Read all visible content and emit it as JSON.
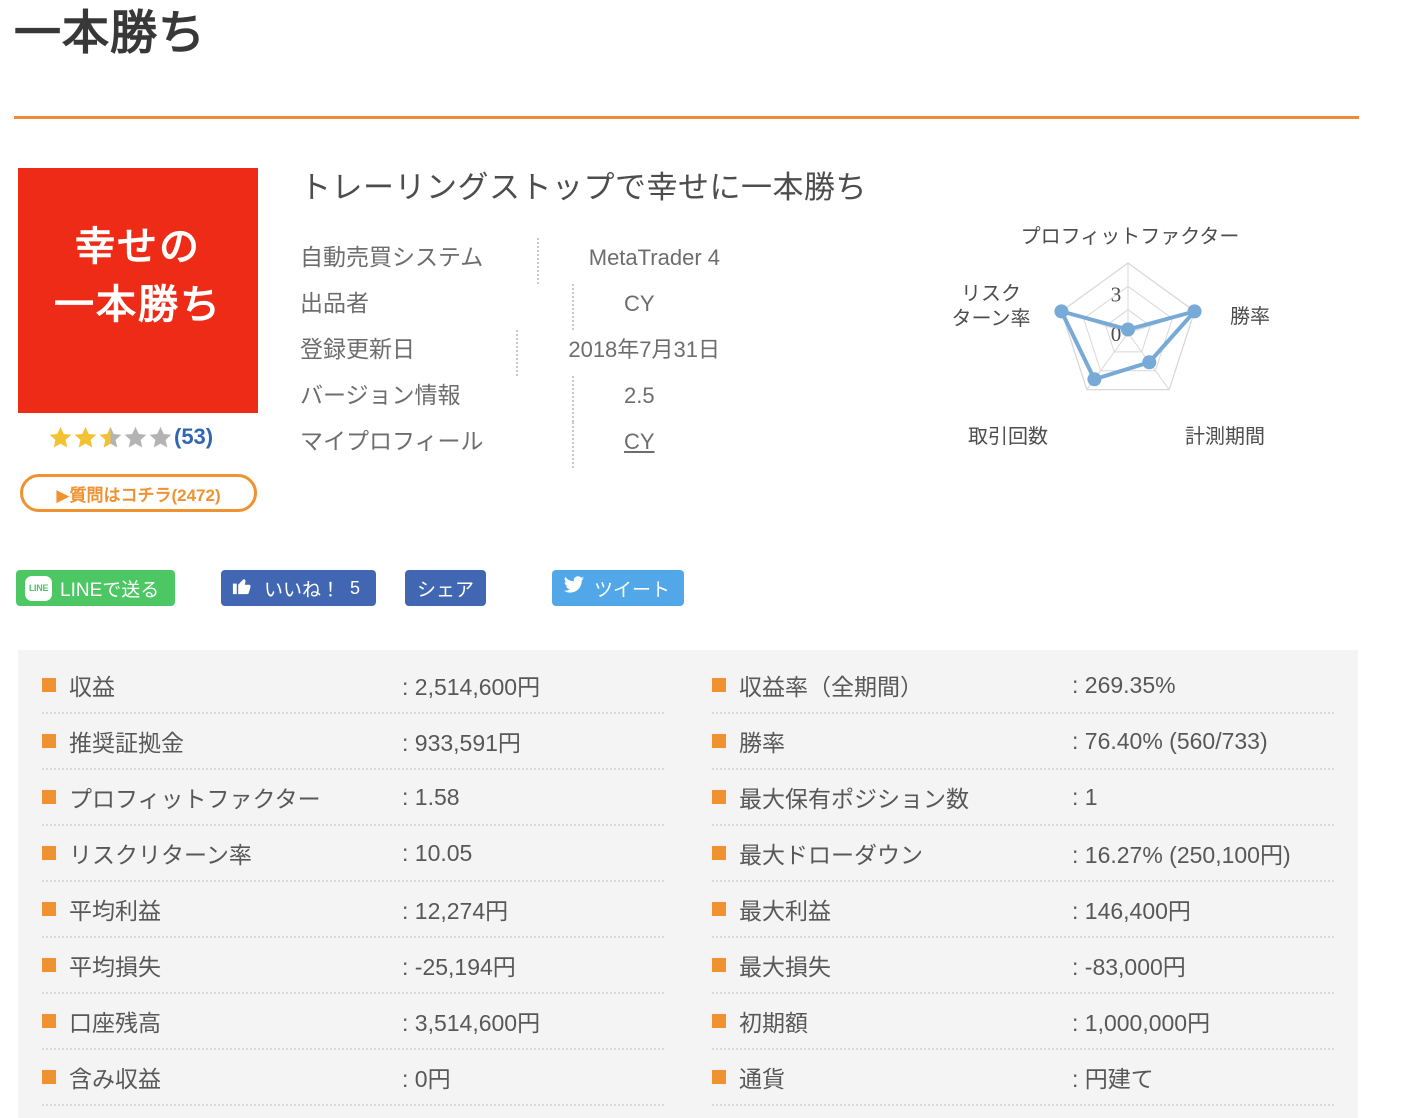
{
  "header": {
    "title": "一本勝ち"
  },
  "product": {
    "thumbnail_lines": [
      "幸せの",
      "一本勝ち"
    ],
    "thumbnail_bg": "#ee2b16",
    "title": "トレーリングストップで幸せに一本勝ち",
    "rating_value": 2.5,
    "rating_max": 5,
    "rating_count": "(53)",
    "question_button": "▶質問はコチラ(2472)",
    "question_count": 2472
  },
  "info": {
    "rows": [
      {
        "label": "自動売買システム",
        "value": "MetaTrader 4",
        "link": false
      },
      {
        "label": "出品者",
        "value": "CY",
        "link": false
      },
      {
        "label": "登録更新日",
        "value": "2018年7月31日",
        "link": false
      },
      {
        "label": "バージョン情報",
        "value": "2.5",
        "link": false
      },
      {
        "label": "マイプロフィール",
        "value": "CY",
        "link": true
      }
    ]
  },
  "chart_data": {
    "type": "radar",
    "title": "",
    "categories": [
      "プロフィットファクター",
      "勝率",
      "計測期間",
      "取引回数",
      "リスクターン率"
    ],
    "label_wrapped": {
      "リスクターン率": [
        "リスク",
        "ターン率"
      ]
    },
    "values": [
      0.15,
      3.0,
      1.55,
      2.45,
      3.0
    ],
    "rmax": 3,
    "tick_labels": [
      "0",
      "3"
    ],
    "tick_values": [
      0,
      3
    ],
    "rings": 3,
    "grid": true,
    "legend": "none",
    "series_color": "#78aad8",
    "grid_color": "#d8d8d8"
  },
  "social": {
    "line": {
      "label": "LINEで送る",
      "badge": "LINE",
      "color": "#4cc764"
    },
    "facebook_like": {
      "label": "いいね！",
      "count": "5",
      "color": "#4267b2"
    },
    "facebook_share": {
      "label": "シェア",
      "color": "#4267b2"
    },
    "twitter": {
      "label": "ツイート",
      "color": "#51a7e8"
    }
  },
  "stats": {
    "bullet_color": "#f0922f",
    "left": [
      {
        "label": "収益",
        "value": ": 2,514,600円"
      },
      {
        "label": "推奨証拠金",
        "value": ": 933,591円"
      },
      {
        "label": "プロフィットファクター",
        "value": ": 1.58"
      },
      {
        "label": "リスクリターン率",
        "value": ": 10.05"
      },
      {
        "label": "平均利益",
        "value": ": 12,274円"
      },
      {
        "label": "平均損失",
        "value": ": -25,194円"
      },
      {
        "label": "口座残高",
        "value": ": 3,514,600円"
      },
      {
        "label": "含み収益",
        "value": ": 0円"
      }
    ],
    "right": [
      {
        "label": "収益率（全期間）",
        "value": ": 269.35%"
      },
      {
        "label": "勝率",
        "value": ": 76.40% (560/733)"
      },
      {
        "label": "最大保有ポジション数",
        "value": ": 1"
      },
      {
        "label": "最大ドローダウン",
        "value": ": 16.27% (250,100円)"
      },
      {
        "label": "最大利益",
        "value": ": 146,400円"
      },
      {
        "label": "最大損失",
        "value": ": -83,000円"
      },
      {
        "label": "初期額",
        "value": ": 1,000,000円"
      },
      {
        "label": "通貨",
        "value": ": 円建て"
      }
    ]
  }
}
